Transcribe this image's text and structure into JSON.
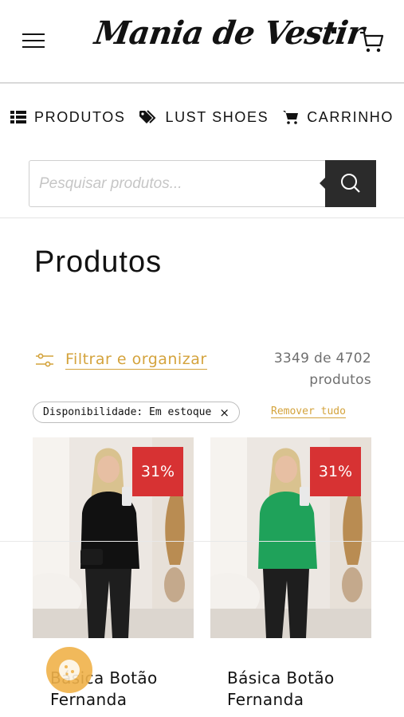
{
  "header": {
    "logo_text": "Mania de Vestir",
    "menu_icon": "hamburger-menu-icon",
    "cart_icon": "shopping-cart-icon"
  },
  "nav": {
    "items": [
      {
        "label": "PRODUTOS",
        "icon": "list-icon"
      },
      {
        "label": "LUST SHOES",
        "icon": "tag-icon"
      },
      {
        "label": "CARRINHO",
        "icon": "cart-icon"
      }
    ]
  },
  "search": {
    "placeholder": "Pesquisar produtos...",
    "value": "",
    "icon": "search-icon"
  },
  "page": {
    "title": "Produtos"
  },
  "filters": {
    "filter_label": "Filtrar e organizar",
    "count_line1": "3349 de 4702",
    "count_line2": "produtos",
    "active_chip": "Disponibilidade: Em estoque",
    "chip_close": "×",
    "remove_all": "Remover tudo"
  },
  "products": [
    {
      "discount": "31%",
      "name_line1": "Básica Botão",
      "name_line2": "Fernanda",
      "top_color": "#111111"
    },
    {
      "discount": "31%",
      "name_line1": "Básica Botão",
      "name_line2": "Fernanda",
      "top_color": "#1fa25a"
    }
  ],
  "colors": {
    "accent": "#d4a33c",
    "badge": "#d73233",
    "search_button": "#2b2b2b"
  }
}
